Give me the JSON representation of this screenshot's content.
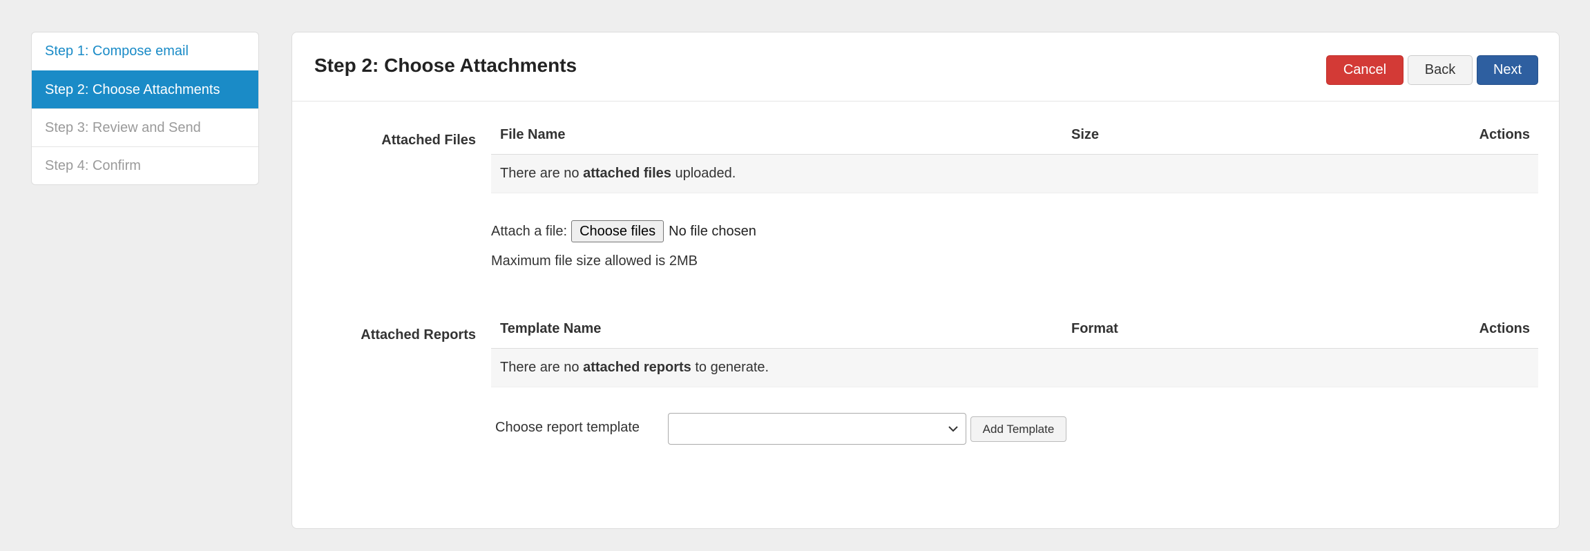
{
  "steps": [
    {
      "label": "Step 1: Compose email",
      "state": "link"
    },
    {
      "label": "Step 2: Choose Attachments",
      "state": "active"
    },
    {
      "label": "Step 3: Review and Send",
      "state": "disabled"
    },
    {
      "label": "Step 4: Confirm",
      "state": "disabled"
    }
  ],
  "header": {
    "title": "Step 2: Choose Attachments",
    "cancel_label": "Cancel",
    "back_label": "Back",
    "next_label": "Next"
  },
  "files": {
    "section_label": "Attached Files",
    "columns": [
      "File Name",
      "Size",
      "Actions"
    ],
    "empty_prefix": "There are no ",
    "empty_bold": "attached files",
    "empty_suffix": " uploaded.",
    "attach_label": "Attach a file:",
    "choose_button": "Choose files",
    "no_file_text": "No file chosen",
    "max_size_text": "Maximum file size allowed is 2MB"
  },
  "reports": {
    "section_label": "Attached Reports",
    "columns": [
      "Template Name",
      "Format",
      "Actions"
    ],
    "empty_prefix": "There are no ",
    "empty_bold": "attached reports",
    "empty_suffix": " to generate.",
    "choose_label": "Choose report template",
    "selected_template": "",
    "add_button": "Add Template"
  },
  "colors": {
    "accent": "#1a8bc7",
    "cancel": "#d33a36",
    "next": "#2e5fa0"
  }
}
